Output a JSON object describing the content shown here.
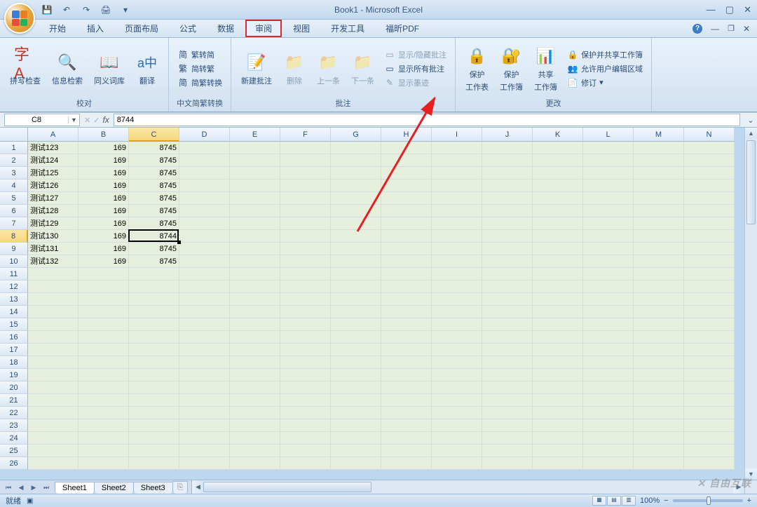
{
  "title": "Book1 - Microsoft Excel",
  "qat": {
    "save": "💾",
    "undo": "↶",
    "redo": "↷",
    "print": "🖨"
  },
  "tabs": [
    "开始",
    "插入",
    "页面布局",
    "公式",
    "数据",
    "审阅",
    "视图",
    "开发工具",
    "福昕PDF"
  ],
  "active_tab": "审阅",
  "ribbon": {
    "proofing": {
      "label": "校对",
      "spelling": "拼写检查",
      "research": "信息检索",
      "thesaurus": "同义词库",
      "translate": "翻译"
    },
    "chinese": {
      "label": "中文简繁转换",
      "t2s": "繁转简",
      "s2t": "简转繁",
      "conv": "简繁转换"
    },
    "comments": {
      "label": "批注",
      "new": "新建批注",
      "delete": "删除",
      "prev": "上一条",
      "next": "下一条",
      "showhide": "显示/隐藏批注",
      "showall": "显示所有批注",
      "showink": "显示墨迹"
    },
    "changes": {
      "label": "更改",
      "protect_sheet_l1": "保护",
      "protect_sheet_l2": "工作表",
      "protect_book_l1": "保护",
      "protect_book_l2": "工作簿",
      "share_book_l1": "共享",
      "share_book_l2": "工作簿",
      "protect_share": "保护并共享工作簿",
      "allow_edit": "允许用户编辑区域",
      "track": "修订"
    }
  },
  "namebox": "C8",
  "formula_value": "8744",
  "columns": [
    "A",
    "B",
    "C",
    "D",
    "E",
    "F",
    "G",
    "H",
    "I",
    "J",
    "K",
    "L",
    "M",
    "N"
  ],
  "active_col": "C",
  "active_row": 8,
  "row_count": 26,
  "data_rows": [
    {
      "a": "测试123",
      "b": 169,
      "c": 8745
    },
    {
      "a": "测试124",
      "b": 169,
      "c": 8745
    },
    {
      "a": "测试125",
      "b": 169,
      "c": 8745
    },
    {
      "a": "测试126",
      "b": 169,
      "c": 8745
    },
    {
      "a": "测试127",
      "b": 169,
      "c": 8745
    },
    {
      "a": "测试128",
      "b": 169,
      "c": 8745
    },
    {
      "a": "测试129",
      "b": 169,
      "c": 8745
    },
    {
      "a": "测试130",
      "b": 169,
      "c": 8744
    },
    {
      "a": "测试131",
      "b": 169,
      "c": 8745
    },
    {
      "a": "测试132",
      "b": 169,
      "c": 8745
    }
  ],
  "sheets": [
    "Sheet1",
    "Sheet2",
    "Sheet3"
  ],
  "active_sheet": "Sheet1",
  "status": "就绪",
  "zoom": "100%",
  "watermark": "✕ 自由互联"
}
